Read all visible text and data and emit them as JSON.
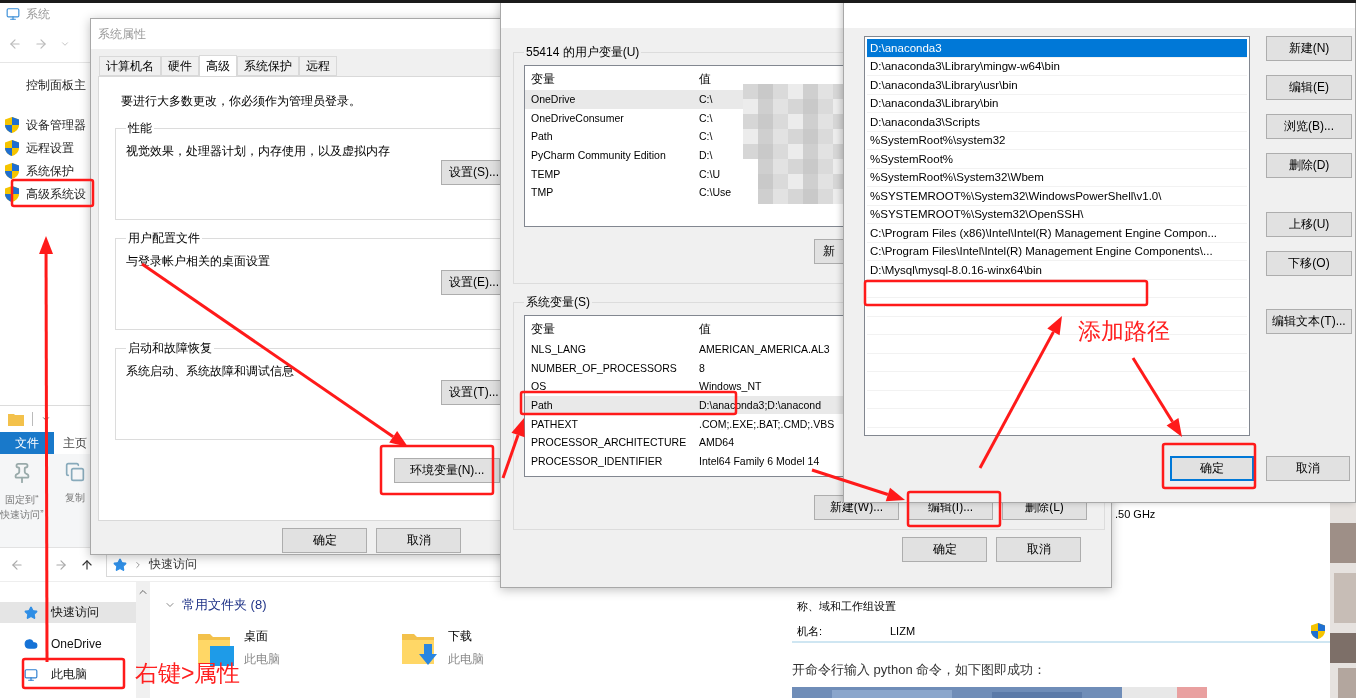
{
  "system_window": {
    "title": "系统",
    "home_link": "控制面板主",
    "links": [
      {
        "label": "设备管理器"
      },
      {
        "label": "远程设置"
      },
      {
        "label": "系统保护"
      },
      {
        "label": "高级系统设"
      }
    ]
  },
  "explorer": {
    "ribbon_tabs": [
      {
        "label": "文件",
        "selected": true
      },
      {
        "label": "主页",
        "selected": false
      }
    ],
    "ribbon_buttons": [
      {
        "kind": "pin",
        "label": "固定到“\n快速访问”"
      },
      {
        "kind": "copy",
        "label": "复制"
      }
    ],
    "address": "快速访问",
    "nav_items": [
      {
        "kind": "quick",
        "label": "快速访问",
        "selected": true
      },
      {
        "kind": "cloud",
        "label": "OneDrive",
        "selected": false
      },
      {
        "kind": "pc",
        "label": "此电脑",
        "selected": false
      }
    ],
    "section": "常用文件夹 (8)",
    "folders": [
      {
        "kind": "desktop",
        "name": "桌面",
        "location": "此电脑"
      },
      {
        "kind": "downloads",
        "name": "下载",
        "location": "此电脑"
      }
    ]
  },
  "system_properties": {
    "title": "系统属性",
    "tabs": [
      {
        "label": "计算机名",
        "selected": false
      },
      {
        "label": "硬件",
        "selected": false
      },
      {
        "label": "高级",
        "selected": true
      },
      {
        "label": "系统保护",
        "selected": false
      },
      {
        "label": "远程",
        "selected": false
      }
    ],
    "notice": "要进行大多数更改，你必须作为管理员登录。",
    "groups": [
      {
        "title": "性能",
        "description": "视觉效果，处理器计划，内存使用，以及虚拟内存",
        "button": "设置(S)..."
      },
      {
        "title": "用户配置文件",
        "description": "与登录帐户相关的桌面设置",
        "button": "设置(E)..."
      },
      {
        "title": "启动和故障恢复",
        "description": "系统启动、系统故障和调试信息",
        "button": "设置(T)..."
      }
    ],
    "env_button": "环境变量(N)...",
    "buttons": [
      "确定",
      "取消"
    ]
  },
  "environment_variables": {
    "user_group": "55414 的用户变量(U)",
    "columns": [
      "变量",
      "值"
    ],
    "user_rows": [
      {
        "name": "OneDrive",
        "value": "C:\\",
        "selected": true
      },
      {
        "name": "OneDriveConsumer",
        "value": "C:\\",
        "selected": false
      },
      {
        "name": "Path",
        "value": "C:\\",
        "selected": false
      },
      {
        "name": "PyCharm Community Edition",
        "value": "D:\\",
        "selected": false
      },
      {
        "name": "TEMP",
        "value": "C:\\U",
        "selected": false
      },
      {
        "name": "TMP",
        "value": "C:\\Use",
        "selected": false
      }
    ],
    "user_buttons": [
      "新"
    ],
    "system_group": "系统变量(S)",
    "system_columns": [
      "变量",
      "值"
    ],
    "system_rows": [
      {
        "name": "NLS_LANG",
        "value": "AMERICAN_AMERICA.AL3",
        "selected": false
      },
      {
        "name": "NUMBER_OF_PROCESSORS",
        "value": "8",
        "selected": false
      },
      {
        "name": "OS",
        "value": "Windows_NT",
        "selected": false
      },
      {
        "name": "Path",
        "value": "D:\\anaconda3;D:\\anacond",
        "selected": true
      },
      {
        "name": "PATHEXT",
        "value": ".COM;.EXE;.BAT;.CMD;.VBS",
        "selected": false
      },
      {
        "name": "PROCESSOR_ARCHITECTURE",
        "value": "AMD64",
        "selected": false
      },
      {
        "name": "PROCESSOR_IDENTIFIER",
        "value": "Intel64 Family 6 Model 14",
        "selected": false
      }
    ],
    "system_buttons": [
      "新建(W)...",
      "编辑(I)...",
      "删除(L)"
    ],
    "buttons": [
      "确定",
      "取消"
    ]
  },
  "edit_dialog": {
    "entries": [
      {
        "path": "D:\\anaconda3",
        "selected": true
      },
      {
        "path": "D:\\anaconda3\\Library\\mingw-w64\\bin",
        "selected": false
      },
      {
        "path": "D:\\anaconda3\\Library\\usr\\bin",
        "selected": false
      },
      {
        "path": "D:\\anaconda3\\Library\\bin",
        "selected": false
      },
      {
        "path": "D:\\anaconda3\\Scripts",
        "selected": false
      },
      {
        "path": "%SystemRoot%\\system32",
        "selected": false
      },
      {
        "path": "%SystemRoot%",
        "selected": false
      },
      {
        "path": "%SystemRoot%\\System32\\Wbem",
        "selected": false
      },
      {
        "path": "%SYSTEMROOT%\\System32\\WindowsPowerShell\\v1.0\\",
        "selected": false
      },
      {
        "path": "%SYSTEMROOT%\\System32\\OpenSSH\\",
        "selected": false
      },
      {
        "path": "C:\\Program Files (x86)\\Intel\\Intel(R) Management Engine Compon...",
        "selected": false
      },
      {
        "path": "C:\\Program Files\\Intel\\Intel(R) Management Engine Components\\...",
        "selected": false
      },
      {
        "path": "D:\\Mysql\\mysql-8.0.16-winx64\\bin",
        "selected": false
      }
    ],
    "side_buttons": [
      {
        "label": "新建(N)"
      },
      {
        "label": "编辑(E)"
      },
      {
        "label": "浏览(B)..."
      },
      {
        "label": "删除(D)"
      },
      {
        "label": "上移(U)"
      },
      {
        "label": "下移(O)"
      },
      {
        "label": "编辑文本(T)..."
      }
    ],
    "footer_buttons": [
      {
        "label": "确定",
        "focused": true
      },
      {
        "label": "取消",
        "focused": false
      }
    ]
  },
  "background": {
    "cpu_speed": ".50 GHz",
    "section": "称、域和工作组设置",
    "rows": [
      {
        "label": "机名:",
        "value": "LIZM"
      }
    ],
    "article_text": "开命令行输入 python 命令，如下图即成功："
  },
  "annotations": [
    {
      "text": "右键>属性"
    },
    {
      "text": "添加路径"
    }
  ]
}
